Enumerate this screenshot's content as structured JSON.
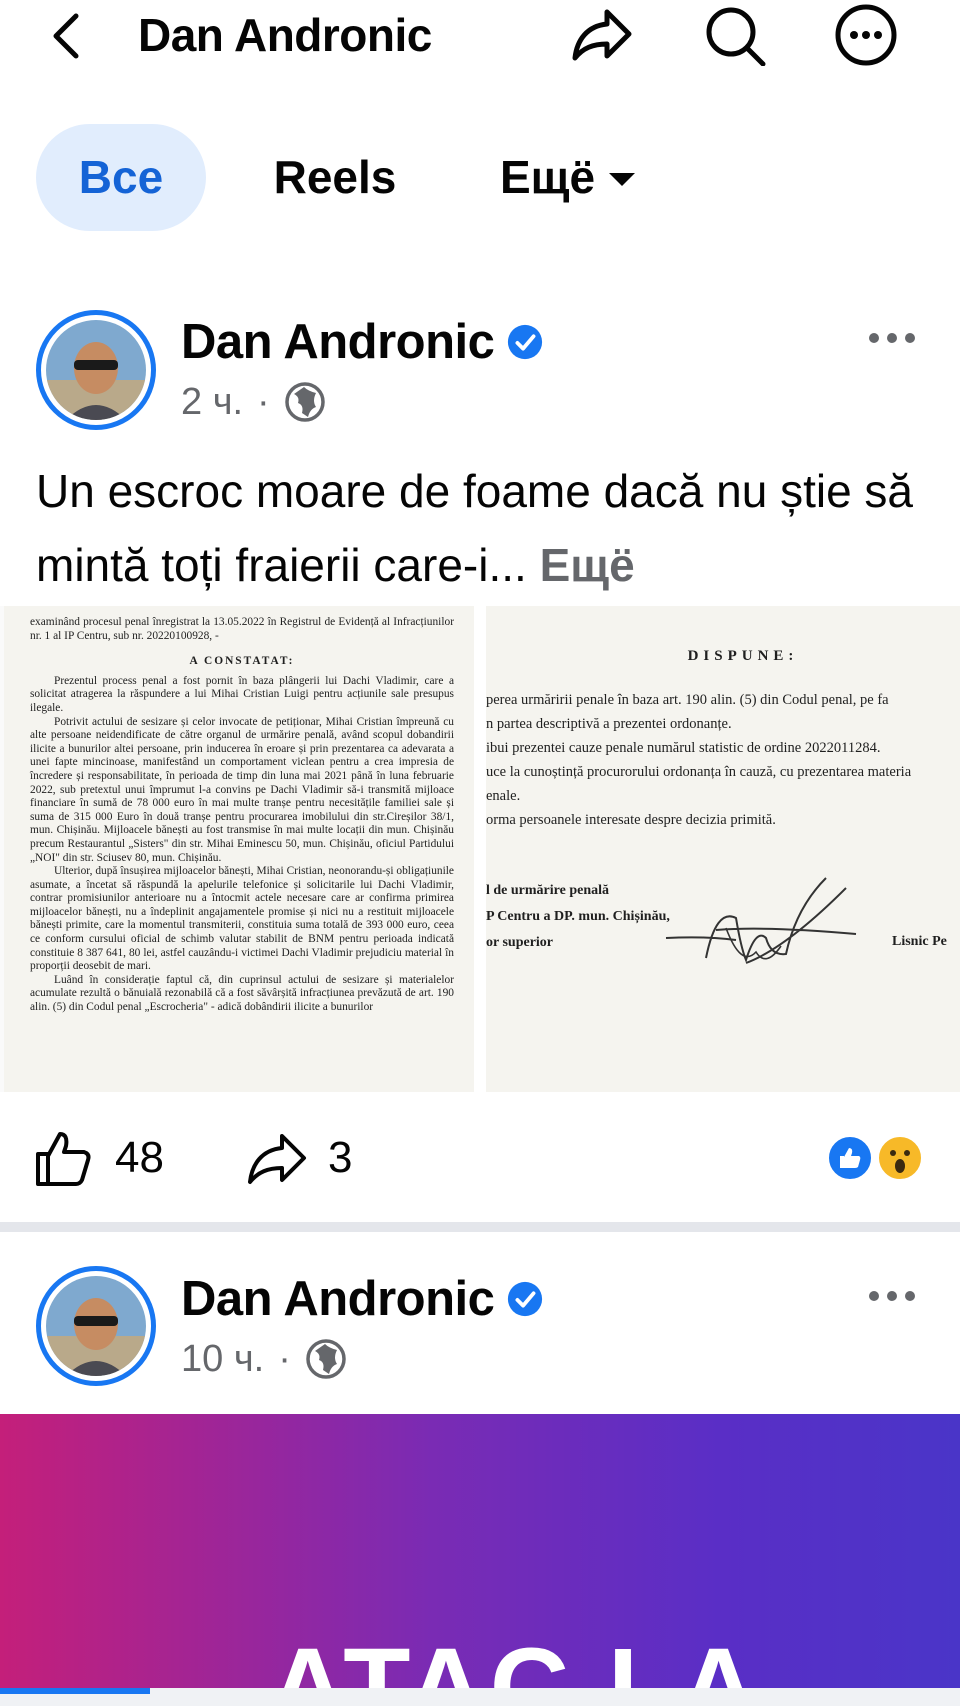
{
  "header": {
    "title": "Dan Andronic",
    "icons": [
      "back-arrow-icon",
      "share-icon",
      "search-icon",
      "more-icon"
    ]
  },
  "tabs": [
    {
      "label": "Все",
      "active": true
    },
    {
      "label": "Reels",
      "active": false
    },
    {
      "label": "Ещё",
      "active": false
    }
  ],
  "posts": [
    {
      "author": "Dan Andronic",
      "verified": true,
      "time": "2 ч.",
      "separator": "·",
      "audience_icon": "globe-icon",
      "text": "Un escroc moare de foame dacă nu știe să mintă toți fraierii care-i...",
      "see_more": "Ещё",
      "document_left": {
        "intro": "examinând procesul penal înregistrat la 13.05.2022 în Registrul de Evidență al Infracțiunilor nr. 1 al IP Centru, sub nr. 20220100928, -",
        "heading": "A CONSTATAT:",
        "paragraphs": [
          "Prezentul process penal a fost pornit în baza plângerii lui Dachi Vladimir, care a solicitat atragerea la răspundere a lui Mihai Cristian Luigi pentru acțiunile sale presupus ilegale.",
          "Potrivit actului de sesizare și celor invocate de petiționar, Mihai Cristian împreună cu alte persoane neidendificate de către organul de urmărire penală, având scopul dobandirii ilicite a bunurilor altei persoane, prin inducerea în eroare și prin prezentarea ca adevarata a unei fapte mincinoase, manifestând un comportament viclean pentru a crea impresia de încredere și responsabilitate, în perioada de timp din luna mai 2021 până în luna februarie 2022, sub pretextul unui împrumut l-a convins pe Dachi Vladimir să-i transmită mijloace financiare în sumă de 78 000 euro în mai multe tranșe pentru necesitățile familiei sale și suma de 315 000 Euro în două tranșe pentru procurarea imobilului din str.Cireșilor 38/1, mun. Chișinău. Mijloacele bănești au fost transmise în mai multe locații din mun. Chișinău precum Restaurantul „Sisters\" din str. Mihai Eminescu 50, mun. Chișinău, oficiul Partidului „NOI\" din str. Sciusev 80, mun. Chișinău.",
          "Ulterior, după însușirea mijloacelor bănești, Mihai Cristian, neonorandu-și obligațiunile asumate, a încetat să răspundă la apelurile telefonice și solicitarile lui Dachi Vladimir, contrar promisiunilor anterioare nu a întocmit actele necesare care ar confirma primirea mijloacelor bănești, nu a îndeplinit angajamentele promise și nici nu a restituit mijloacele bănești primite, care la momentul transmiterii, constituia suma totală de 393 000 euro, ceea ce conform cursului oficial de schimb valutar stabilit de BNM pentru perioada indicată constituie 8 387 641, 80 lei, astfel cauzându-i victimei Dachi Vladimir prejudiciu material în proporții deosebit de mari.",
          "Luând în considerație faptul că, din cuprinsul actului de sesizare și materialelor acumulate rezultă o bănuială rezonabilă că a fost săvârșită infracțiunea prevăzută de art. 190 alin. (5) din Codul penal „Escrocheria\" - adică dobândirii ilicite a bunurilor"
        ]
      },
      "document_right": {
        "heading": "DISPUNE:",
        "lines": [
          "perea urmăririi penale în baza art. 190 alin. (5) din Codul penal, pe fa",
          "n partea descriptivă a prezentei ordonanțe.",
          "ibui prezentei cauze penale numărul statistic de ordine 2022011284.",
          "uce la cunoștință procurorului ordonanța în cauză, cu prezentarea materia",
          "enale.",
          "orma persoanele interesate despre decizia primită."
        ],
        "signature_lines": [
          "l de urmărire penală",
          "P Centru a DP. mun. Chișinău,",
          "or superior"
        ],
        "signer": "Lisnic Pe"
      },
      "likes": "48",
      "shares": "3",
      "reactions": [
        "like-reaction-icon",
        "wow-reaction-icon"
      ]
    },
    {
      "author": "Dan Andronic",
      "verified": true,
      "time": "10 ч.",
      "separator": "·",
      "audience_icon": "globe-icon",
      "banner_text": "ATAC LA"
    }
  ],
  "colors": {
    "accent": "#1877f2",
    "active_tab_bg": "#e1edfd",
    "active_tab_text": "#1463d6",
    "meta_text": "#65676b",
    "banner_gradient": [
      "#c41f7a",
      "#7a2bb4",
      "#4a35c8"
    ]
  }
}
